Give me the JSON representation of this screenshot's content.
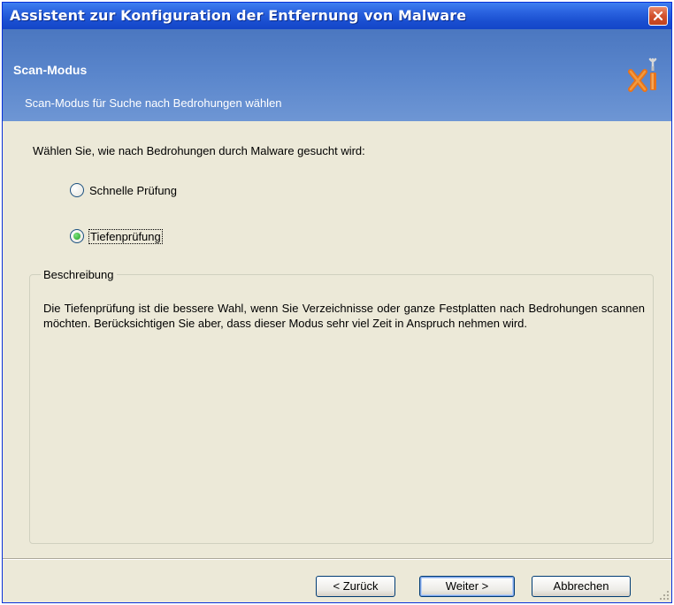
{
  "window": {
    "title": "Assistent zur Konfiguration der Entfernung von Malware",
    "close_icon": "close-icon"
  },
  "header": {
    "title": "Scan-Modus",
    "subtitle": "Scan-Modus für Suche nach Bedrohungen wählen",
    "logo": "xi-logo-icon"
  },
  "content": {
    "intro": "Wählen Sie, wie nach Bedrohungen durch Malware gesucht wird:",
    "options": [
      {
        "label": "Schnelle Prüfung",
        "checked": false
      },
      {
        "label": "Tiefenprüfung",
        "checked": true
      }
    ]
  },
  "description": {
    "legend": "Beschreibung",
    "text": "Die Tiefenprüfung ist die bessere Wahl, wenn Sie Verzeichnisse oder ganze Festplatten nach Bedrohungen scannen möchten. Berücksichtigen Sie aber, dass dieser Modus sehr viel Zeit in Anspruch nehmen wird."
  },
  "buttons": {
    "back": "< Zurück",
    "next": "Weiter >",
    "cancel": "Abbrechen"
  },
  "colors": {
    "title_bar": "#2A63E0",
    "header_band": "#5A86CC",
    "dialog_face": "#ECE9D8",
    "radio_selected": "#21A121"
  }
}
